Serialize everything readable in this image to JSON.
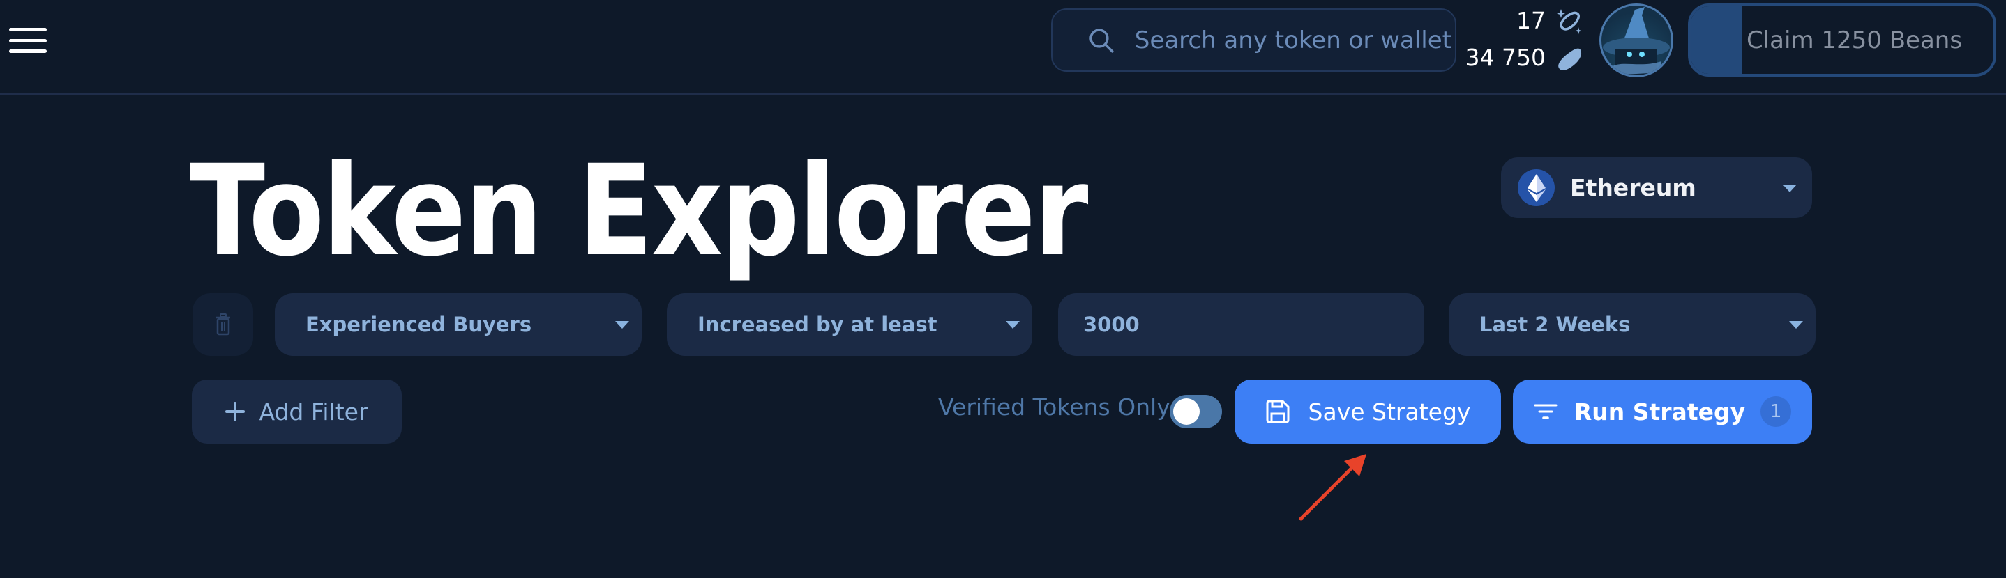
{
  "header": {
    "menu_icon": "hamburger-menu-icon",
    "search": {
      "placeholder": "Search any token or wallet",
      "value": "",
      "icon": "search-icon"
    },
    "counters": [
      {
        "value": "17",
        "icon": "sparkle-bean-outline-icon"
      },
      {
        "value": "34 750",
        "icon": "bean-filled-icon"
      }
    ],
    "avatar": {
      "icon": "wizard-avatar"
    },
    "claim_button": {
      "label": "Claim 1250 Beans",
      "progress_percent": 17
    }
  },
  "page": {
    "title": "Token Explorer",
    "chain_select": {
      "value": "Ethereum",
      "icon": "ethereum-icon"
    }
  },
  "filters": [
    {
      "metric": "Experienced Buyers",
      "operator": "Increased by at least",
      "value": "3000",
      "timeframe": "Last 2 Weeks"
    }
  ],
  "actions": {
    "add_filter_label": "Add Filter",
    "verified_only_label": "Verified Tokens Only",
    "verified_only_enabled": false,
    "save_label": "Save Strategy",
    "run_label": "Run Strategy",
    "run_badge": "1"
  },
  "colors": {
    "background": "#0e1929",
    "primary": "#3d7ff5",
    "surface": "#1b2a45",
    "muted_text": "#8fb3dc",
    "annotation_arrow": "#e8432a"
  }
}
